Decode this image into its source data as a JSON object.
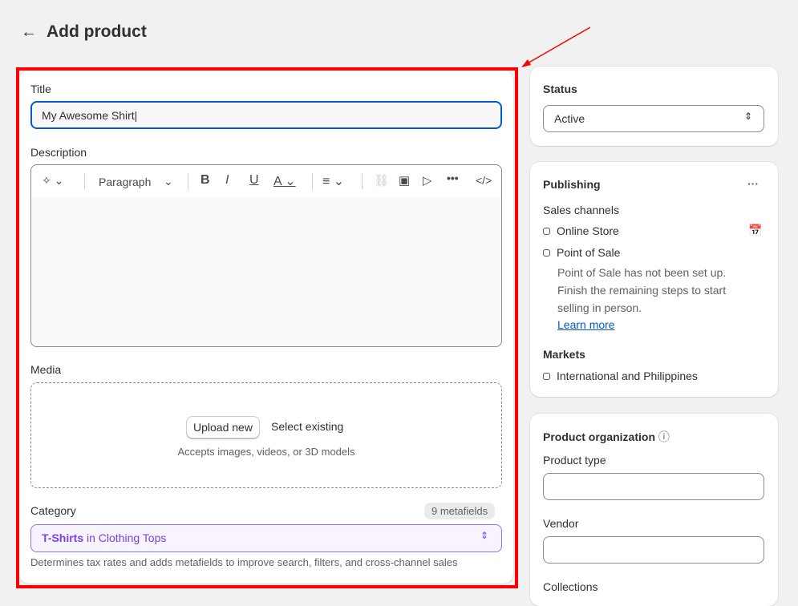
{
  "header": {
    "title": "Add product"
  },
  "product": {
    "title_label": "Title",
    "title_value": "My Awesome Shirt",
    "description_label": "Description",
    "toolbar": {
      "paragraph": "Paragraph"
    },
    "media_label": "Media",
    "upload_new": "Upload new",
    "select_existing": "Select existing",
    "media_hint": "Accepts images, videos, or 3D models",
    "category_label": "Category",
    "metafields_badge": "9 metafields",
    "category_value_main": "T-Shirts",
    "category_value_rest": " in Clothing Tops",
    "category_hint": "Determines tax rates and adds metafields to improve search, filters, and cross-channel sales"
  },
  "status": {
    "label": "Status",
    "value": "Active"
  },
  "publishing": {
    "title": "Publishing",
    "sales_channels": "Sales channels",
    "channels": [
      "Online Store",
      "Point of Sale"
    ],
    "pos_note": "Point of Sale has not been set up. Finish the remaining steps to start selling in person.",
    "learn_more": "Learn more",
    "markets_label": "Markets",
    "markets": [
      "International and Philippines"
    ]
  },
  "organization": {
    "title": "Product organization",
    "product_type": "Product type",
    "vendor": "Vendor",
    "collections": "Collections"
  },
  "colors": {
    "annotation": "#ff0000",
    "accent": "#7b3ff2",
    "link": "#005bd3"
  }
}
